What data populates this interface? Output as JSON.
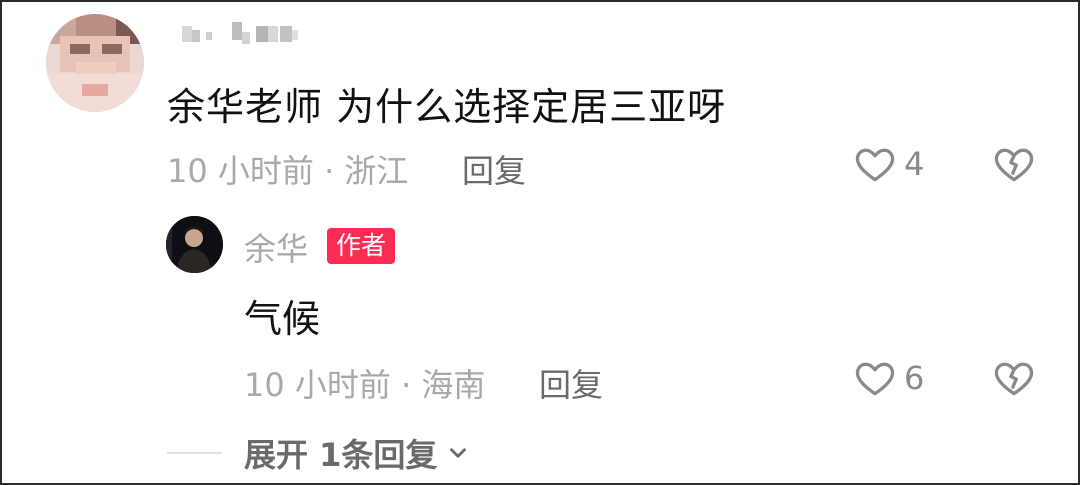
{
  "comment": {
    "username": "█ ▄ █▄█",
    "text": "余华老师 为什么选择定居三亚呀",
    "time_location": "10 小时前 · 浙江",
    "reply_label": "回复",
    "like_count": "4",
    "icons": [
      "avatar",
      "heart-icon",
      "broken-heart-icon"
    ]
  },
  "reply": {
    "author_name": "余华",
    "author_badge": "作者",
    "text": "气候",
    "time_location": "10 小时前 · 海南",
    "reply_label": "回复",
    "like_count": "6",
    "icons": [
      "avatar",
      "heart-icon",
      "broken-heart-icon"
    ]
  },
  "expand": {
    "label": "展开 1条回复",
    "icon": "chevron-down-icon"
  },
  "colors": {
    "badge": "#fe2c55",
    "meta_text": "#a9a9a9",
    "primary_text": "#111111",
    "action_text": "#6a6a6a"
  }
}
